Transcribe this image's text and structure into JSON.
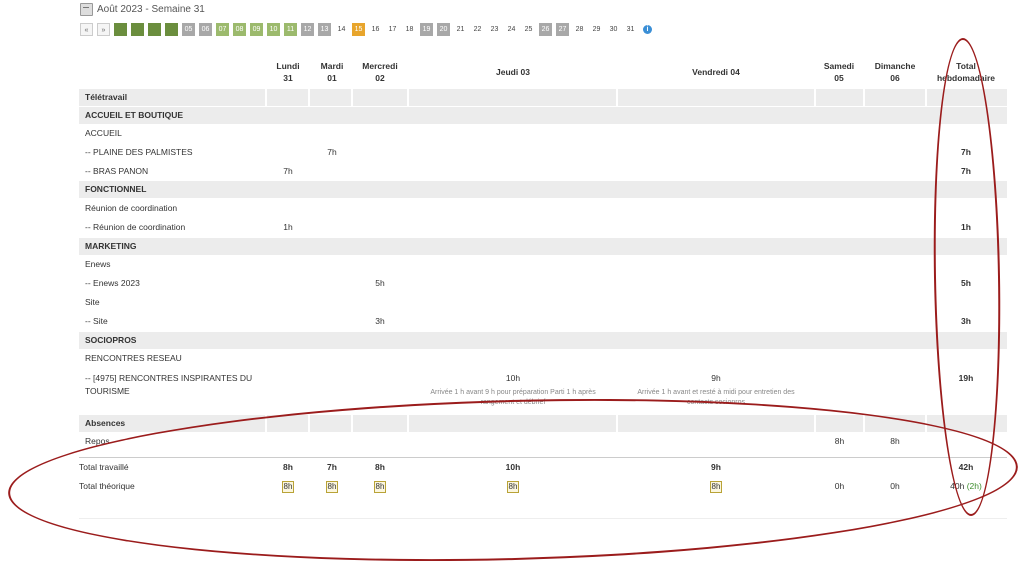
{
  "header": {
    "title": "Août 2023 - Semaine 31"
  },
  "day_picker": {
    "prev": "«",
    "next": "»",
    "days": [
      {
        "label": "",
        "state": "selected"
      },
      {
        "label": "",
        "state": "selected"
      },
      {
        "label": "",
        "state": "selected"
      },
      {
        "label": "",
        "state": "selected"
      },
      {
        "label": "05",
        "state": "grey"
      },
      {
        "label": "06",
        "state": "grey"
      },
      {
        "label": "07",
        "state": "light"
      },
      {
        "label": "08",
        "state": "light"
      },
      {
        "label": "09",
        "state": "light"
      },
      {
        "label": "10",
        "state": "light"
      },
      {
        "label": "11",
        "state": "light"
      },
      {
        "label": "12",
        "state": "grey"
      },
      {
        "label": "13",
        "state": "grey"
      },
      {
        "label": "14",
        "state": "plain"
      },
      {
        "label": "15",
        "state": "orange"
      },
      {
        "label": "16",
        "state": "plain"
      },
      {
        "label": "17",
        "state": "plain"
      },
      {
        "label": "18",
        "state": "plain"
      },
      {
        "label": "19",
        "state": "grey"
      },
      {
        "label": "20",
        "state": "grey"
      },
      {
        "label": "21",
        "state": "plain"
      },
      {
        "label": "22",
        "state": "plain"
      },
      {
        "label": "23",
        "state": "plain"
      },
      {
        "label": "24",
        "state": "plain"
      },
      {
        "label": "25",
        "state": "plain"
      },
      {
        "label": "26",
        "state": "grey"
      },
      {
        "label": "27",
        "state": "grey"
      },
      {
        "label": "28",
        "state": "plain"
      },
      {
        "label": "29",
        "state": "plain"
      },
      {
        "label": "30",
        "state": "plain"
      },
      {
        "label": "31",
        "state": "plain"
      }
    ],
    "info_icon": "i"
  },
  "columns": {
    "lun": [
      "Lundi",
      "31"
    ],
    "mar": [
      "Mardi",
      "01"
    ],
    "mer": [
      "Mercredi",
      "02"
    ],
    "jeu": [
      "Jeudi 03"
    ],
    "ven": [
      "Vendredi 04"
    ],
    "sam": [
      "Samedi",
      "05"
    ],
    "dim": [
      "Dimanche",
      "06"
    ],
    "tot": [
      "Total",
      "hebdomadaire"
    ]
  },
  "sections": {
    "teletravail": "Télétravail",
    "accueil": "ACCUEIL ET BOUTIQUE",
    "accueil_sub": "ACCUEIL",
    "plaine": "-- PLAINE DES PALMISTES",
    "plaine_mar": "7h",
    "plaine_tot": "7h",
    "bras": "-- BRAS PANON",
    "bras_lun": "7h",
    "bras_tot": "7h",
    "fonctionnel": "FONCTIONNEL",
    "reunion_sub": "Réunion de coordination",
    "reunion": "-- Réunion de coordination",
    "reunion_lun": "1h",
    "reunion_tot": "1h",
    "marketing": "MARKETING",
    "enews_sub": "Enews",
    "enews": "-- Enews 2023",
    "enews_mer": "5h",
    "enews_tot": "5h",
    "site_sub": "Site",
    "site": "-- Site",
    "site_mer": "3h",
    "site_tot": "3h",
    "sociopros": "SOCIOPROS",
    "rencontres_sub": "RENCONTRES RESEAU",
    "rencontres_1": "-- [4975] RENCONTRES INSPIRANTES DU",
    "rencontres_2": "TOURISME",
    "rencontres_jeu": "10h",
    "rencontres_ven": "9h",
    "rencontres_tot": "19h",
    "note_jeu_1": "Arrivée 1 h avant 9 h pour préparation Parti 1 h après",
    "note_jeu_2": "rangement et débrief",
    "note_ven_1": "Arrivée 1 h avant et resté à midi pour entretien des",
    "note_ven_2": "contacts socionros",
    "absences": "Absences",
    "repos": "Repos",
    "repos_sam": "8h",
    "repos_dim": "8h"
  },
  "totals": {
    "travaille_label": "Total travaillé",
    "travaille": {
      "lun": "8h",
      "mar": "7h",
      "mer": "8h",
      "jeu": "10h",
      "ven": "9h",
      "tot": "42h"
    },
    "theorique_label": "Total théorique",
    "theorique": {
      "lun": "8h",
      "mar": "8h",
      "mer": "8h",
      "jeu": "8h",
      "ven": "8h",
      "sam": "0h",
      "dim": "0h",
      "tot": "40h",
      "tot_extra": "(2h)"
    }
  },
  "colors": {
    "annotation": "#9b1c1c",
    "selected_day": "#6b8e3e",
    "light_day": "#9cba6d",
    "today": "#e8a52c",
    "row_grey": "#ececec"
  }
}
